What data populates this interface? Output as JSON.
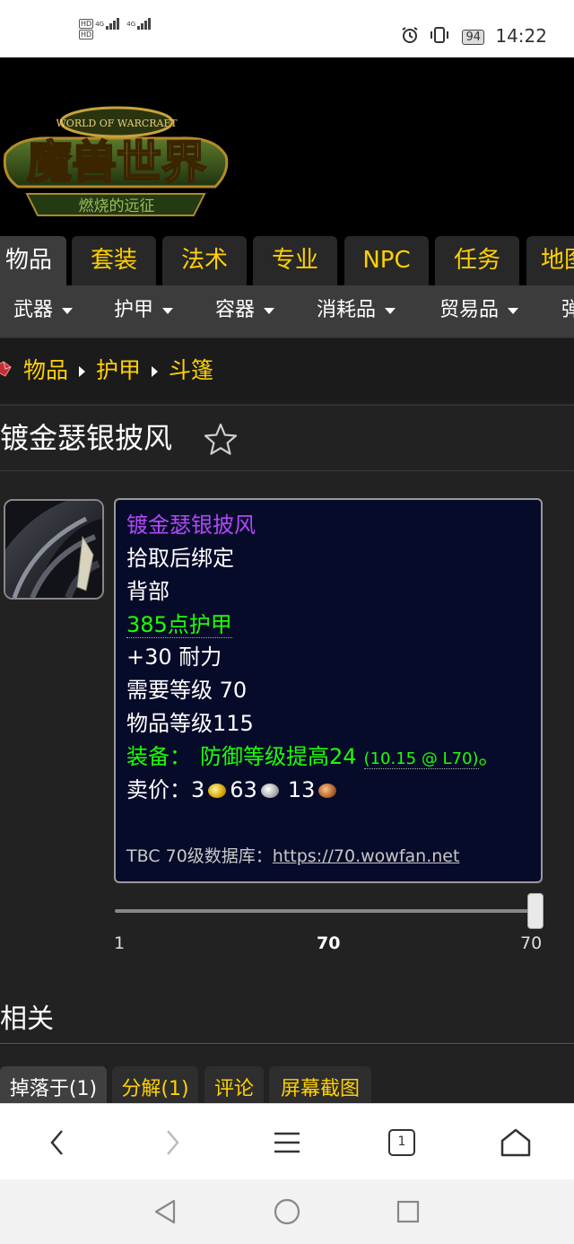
{
  "status_bar": {
    "network1": "4G",
    "network2": "4G",
    "battery": "94",
    "time": "14:22"
  },
  "top_tabs": [
    {
      "label": "物品"
    },
    {
      "label": "套装"
    },
    {
      "label": "法术"
    },
    {
      "label": "专业"
    },
    {
      "label": "NPC"
    },
    {
      "label": "任务"
    },
    {
      "label": "地图"
    }
  ],
  "sub_menu": [
    {
      "label": "武器"
    },
    {
      "label": "护甲"
    },
    {
      "label": "容器"
    },
    {
      "label": "消耗品"
    },
    {
      "label": "贸易品"
    },
    {
      "label": "弹药"
    }
  ],
  "breadcrumb": {
    "items": [
      "物品",
      "护甲",
      "斗篷"
    ]
  },
  "page_title": "镀金瑟银披风",
  "tooltip": {
    "name": "镀金瑟银披风",
    "bind": "拾取后绑定",
    "slot": "背部",
    "armor": "385点护甲",
    "stamina": "+30 耐力",
    "req_level": "需要等级 70",
    "item_level": "物品等级115",
    "equip_prefix": "装备：",
    "equip_text": "防御等级提高24",
    "equip_detail": "(10.15 @ L70)",
    "equip_suffix": "。",
    "sell_label": "卖价：",
    "sell_gold": "3",
    "sell_silver": "63",
    "sell_copper": "13",
    "db_label": "TBC 70级数据库：",
    "db_link": "https://70.wowfan.net"
  },
  "level_slider": {
    "min_label": "1",
    "current_label": "70",
    "max_label": "70",
    "value": 70,
    "min": 1,
    "max": 70
  },
  "related": {
    "title": "相关",
    "tabs": [
      {
        "label": "掉落于(1)"
      },
      {
        "label": "分解(1)"
      },
      {
        "label": "评论"
      },
      {
        "label": "屏幕截图"
      }
    ]
  },
  "browser_bar": {
    "tab_count": "1"
  },
  "colors": {
    "gold_text": "#ffd100",
    "epic_purple": "#b048f8",
    "uncommon_green": "#1eff00",
    "tooltip_bg": "#070b2a"
  }
}
